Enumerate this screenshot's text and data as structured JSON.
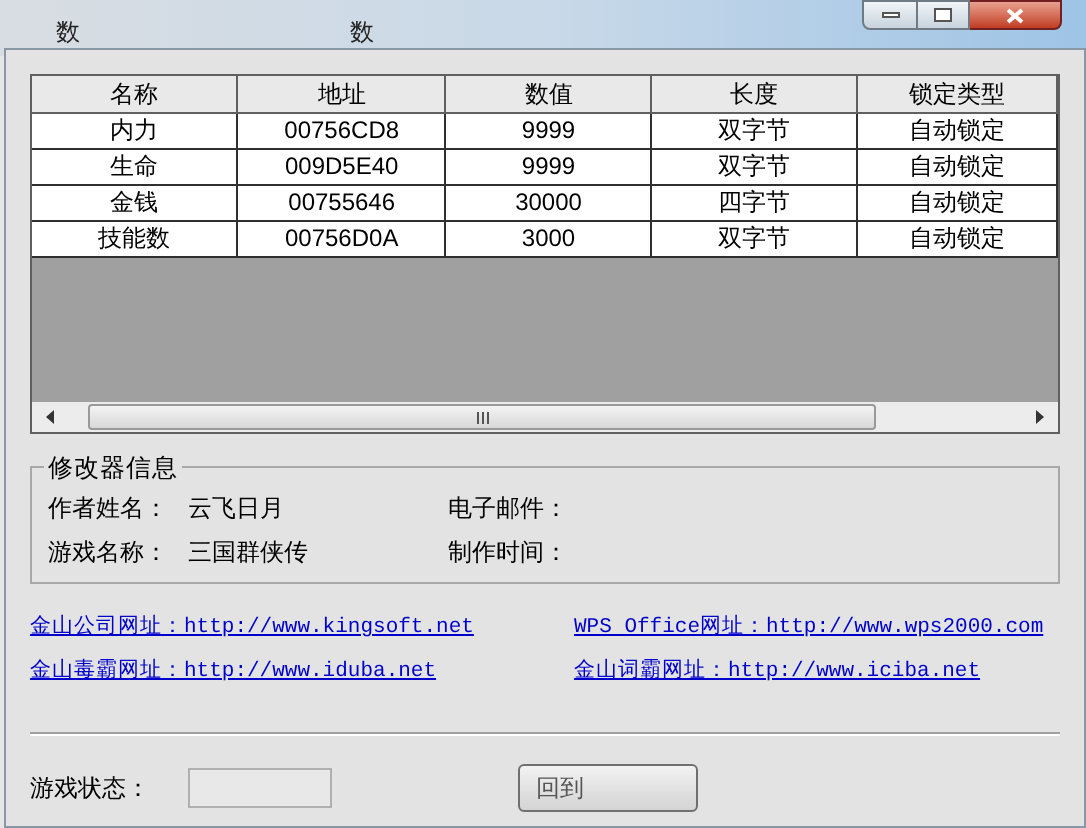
{
  "header_labels": [
    "数",
    "数"
  ],
  "table": {
    "columns": [
      "名称",
      "地址",
      "数值",
      "长度",
      "锁定类型"
    ],
    "rows": [
      [
        "内力",
        "00756CD8",
        "9999",
        "双字节",
        "自动锁定"
      ],
      [
        "生命",
        "009D5E40",
        "9999",
        "双字节",
        "自动锁定"
      ],
      [
        "金钱",
        "00755646",
        "30000",
        "四字节",
        "自动锁定"
      ],
      [
        "技能数",
        "00756D0A",
        "3000",
        "双字节",
        "自动锁定"
      ]
    ]
  },
  "info": {
    "title": "修改器信息",
    "fields": [
      {
        "label": "作者姓名：",
        "value": "云飞日月"
      },
      {
        "label": "电子邮件："
      },
      {
        "label": "游戏名称：",
        "value": "三国群侠传"
      },
      {
        "label": "制作时间："
      }
    ]
  },
  "links": [
    "金山公司网址：http://www.kingsoft.net",
    "WPS Office网址：http://www.wps2000.com",
    "金山毒霸网址：http://www.iduba.net",
    "金山词霸网址：http://www.iciba.net"
  ],
  "status": {
    "label": "游戏状态："
  },
  "buttons": [
    "回到"
  ]
}
